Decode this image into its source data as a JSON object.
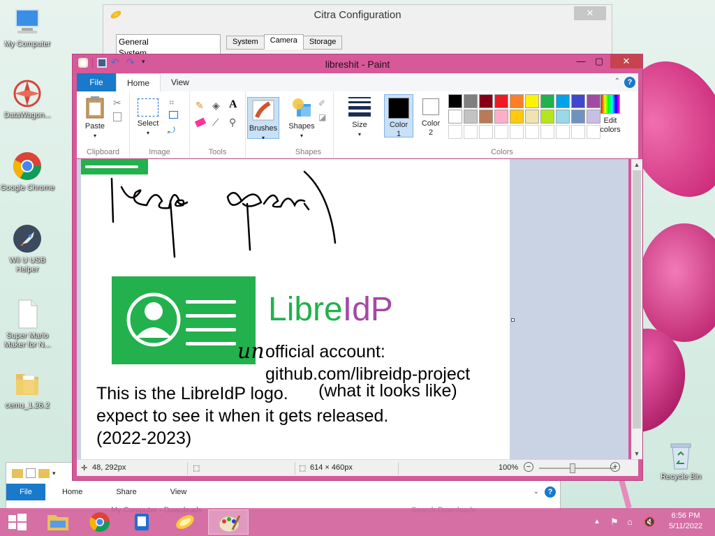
{
  "desktop_icons": [
    {
      "label": "My Computer",
      "icon": "computer-icon"
    },
    {
      "label": "DataWagon...",
      "icon": "datawagon-icon"
    },
    {
      "label": "Google Chrome",
      "icon": "chrome-icon"
    },
    {
      "label": "Wii U USB Helper",
      "icon": "rocket-icon"
    },
    {
      "label": "Super Mario Maker for N...",
      "icon": "file-icon"
    },
    {
      "label": "cemu_1.26.2",
      "icon": "folder-icon"
    },
    {
      "label": "Recycle Bin",
      "icon": "recycle-bin-icon"
    }
  ],
  "citra": {
    "title": "Citra Configuration",
    "close": "✕",
    "sidebar": [
      "General",
      "System"
    ],
    "tabs": [
      "System",
      "Camera",
      "Storage"
    ],
    "active_tab": "Camera"
  },
  "paint": {
    "title": "libreshit - Paint",
    "tabs": {
      "file": "File",
      "home": "Home",
      "view": "View"
    },
    "help": "?",
    "groups": {
      "clipboard": "Clipboard",
      "image": "Image",
      "tools": "Tools",
      "shapes": "Shapes",
      "colors": "Colors"
    },
    "buttons": {
      "paste": "Paste",
      "select": "Select",
      "brushes": "Brushes",
      "shapes": "Shapes",
      "size": "Size",
      "color1": "Color\n1",
      "color1_a": "Color",
      "color1_b": "1",
      "color2_a": "Color",
      "color2_b": "2",
      "edit_colors_a": "Edit",
      "edit_colors_b": "colors"
    },
    "palette_row1": [
      "#000000",
      "#7f7f7f",
      "#880015",
      "#ed1c24",
      "#ff7f27",
      "#fff200",
      "#22b14c",
      "#00a2e8",
      "#3f48cc",
      "#a349a4"
    ],
    "palette_row2": [
      "#ffffff",
      "#c3c3c3",
      "#b97a57",
      "#ffaec9",
      "#ffc90e",
      "#efe4b0",
      "#b5e61d",
      "#99d9ea",
      "#7092be",
      "#c8bfe7"
    ],
    "canvas": {
      "handwriting": "keep open",
      "logo_text_a": "Libre",
      "logo_text_b": "IdP",
      "un": "un",
      "official_line1": "official account:",
      "official_line2": "github.com/libreidp-project",
      "looks_like": "(what it looks like)",
      "body_line1": "This is the LibreIdP logo.",
      "body_line2": "expect to see it when it gets released.",
      "body_line3": "(2022-2023)"
    },
    "status": {
      "cursor": "48, 292px",
      "size": "614 × 460px",
      "zoom": "100%"
    }
  },
  "explorer": {
    "file": "File",
    "tabs": [
      "Home",
      "Share",
      "View"
    ],
    "path": "My Computer  ›  Downloads",
    "search_placeholder": "Search Downloads"
  },
  "tray": {
    "time": "6:56 PM",
    "date": "5/11/2022"
  }
}
